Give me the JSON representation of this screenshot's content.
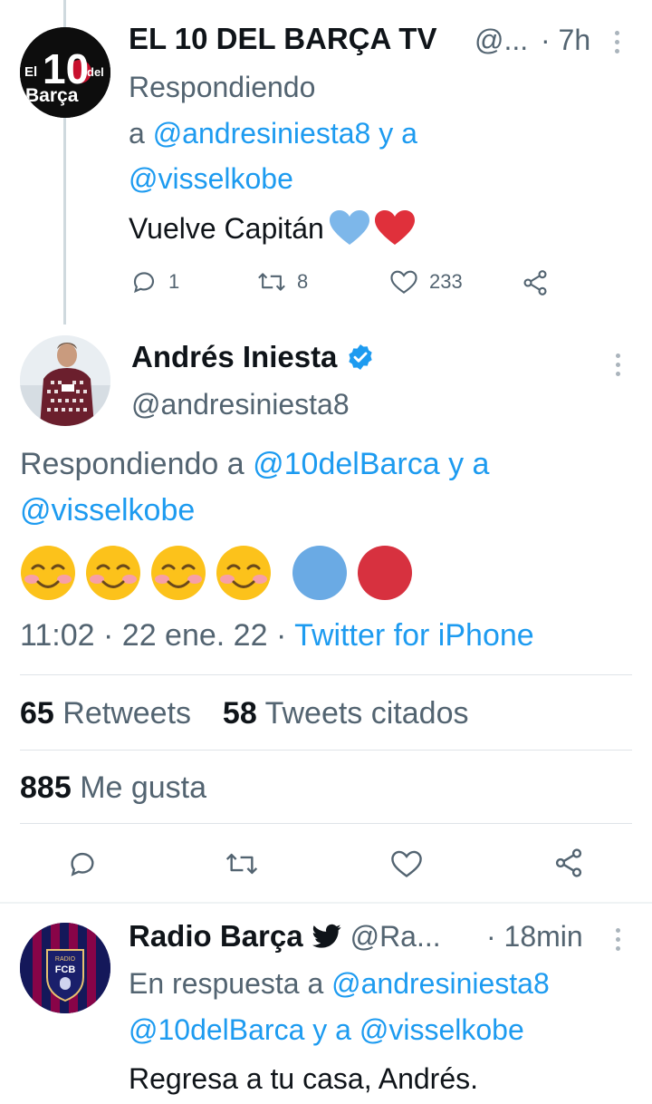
{
  "tweet1": {
    "name": "EL 10 DEL BARÇA TV",
    "handle": "@...",
    "time": "· 7h",
    "reply_prefix": "Respondiendo",
    "reply_a": "a",
    "reply_user1": "@andresiniesta8",
    "reply_and": "y a",
    "reply_user2": "@visselkobe",
    "text": "Vuelve Capitán",
    "emoji": [
      "blue-heart",
      "red-heart"
    ],
    "replies": "1",
    "retweets": "8",
    "likes": "233",
    "avatar_text": {
      "el": "El",
      "ten": "10",
      "del": "del",
      "barca": "Barça"
    }
  },
  "tweet2": {
    "name": "Andrés Iniesta",
    "handle": "@andresiniesta8",
    "reply_prefix": "Respondiendo a",
    "reply_user1": "@10delBarca",
    "reply_and": "y a",
    "reply_user2": "@visselkobe",
    "emoji": [
      "smiling-blush-face",
      "smiling-blush-face",
      "smiling-blush-face",
      "smiling-blush-face",
      "blue-circle",
      "red-circle"
    ],
    "time": "11:02",
    "date": "22 ene. 22",
    "source": "Twitter for iPhone",
    "retweets_count": "65",
    "retweets_label": "Retweets",
    "quotes_count": "58",
    "quotes_label": "Tweets citados",
    "likes_count": "885",
    "likes_label": "Me gusta"
  },
  "tweet3": {
    "name": "Radio Barça",
    "handle": "@Ra...",
    "time": "· 18min",
    "reply_prefix": "En respuesta a",
    "reply_user1": "@andresiniesta8",
    "reply_user2": "@10delBarca",
    "reply_and": "y a",
    "reply_user3": "@visselkobe",
    "text": "Regresa a tu casa, Andrés.",
    "avatar_text": {
      "radio": "RADIO",
      "fcb": "FCB"
    }
  },
  "colors": {
    "accent": "#1d9bf0",
    "grey": "#536471",
    "text": "#0f1419",
    "heart_blue": "#7db7ea",
    "heart_red": "#e0303b"
  }
}
